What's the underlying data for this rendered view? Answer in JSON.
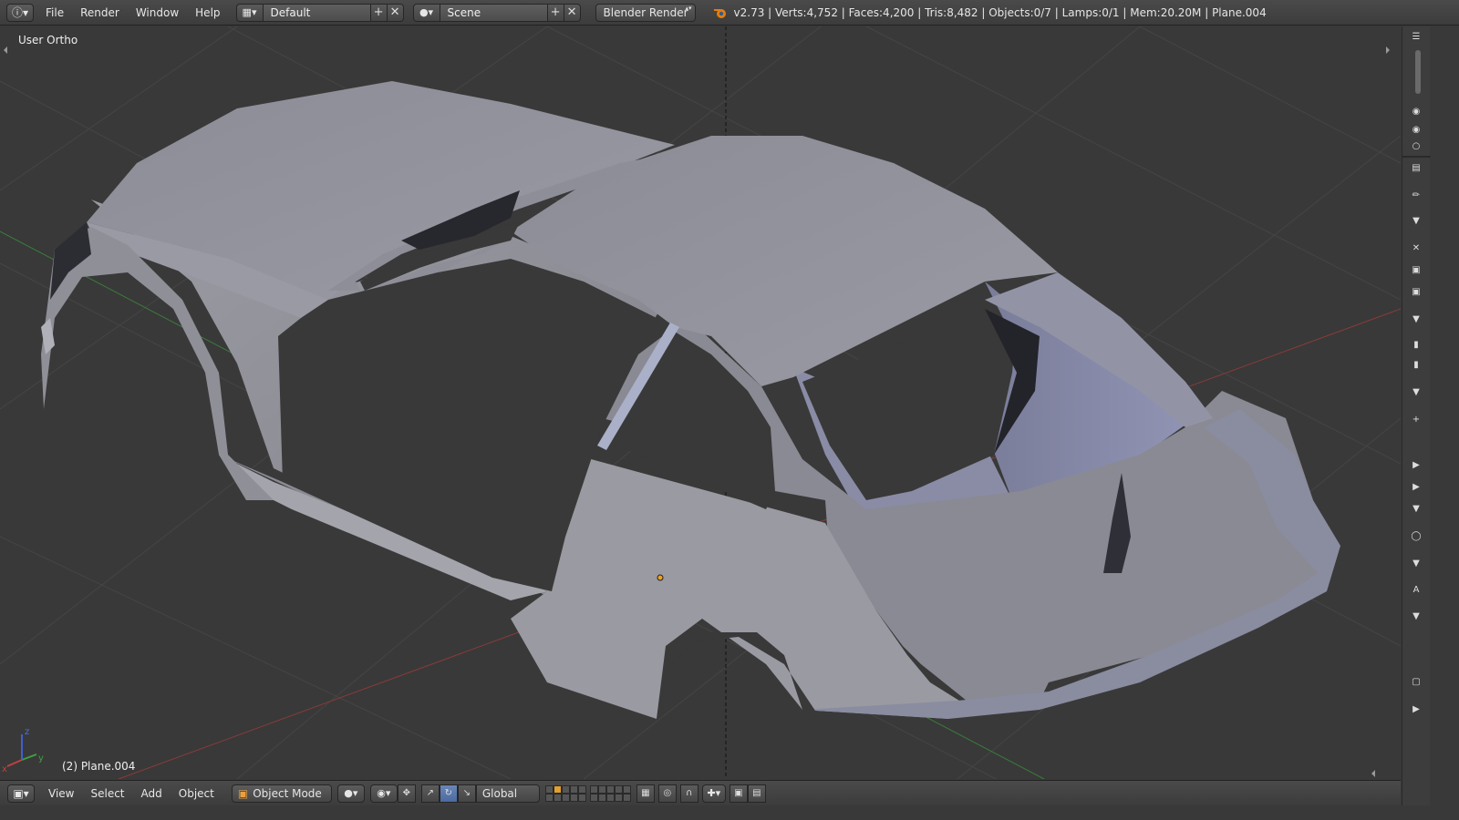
{
  "topbar": {
    "menus": [
      "File",
      "Render",
      "Window",
      "Help"
    ],
    "screen_layout": "Default",
    "scene": "Scene",
    "render_engine": "Blender Render",
    "stats": "v2.73 | Verts:4,752 | Faces:4,200 | Tris:8,482 | Objects:0/7 | Lamps:0/1 | Mem:20.20M | Plane.004"
  },
  "viewport": {
    "view_label": "User Ortho",
    "object_label": "(2) Plane.004",
    "axis_labels": {
      "x": "x",
      "y": "y",
      "z": "z"
    },
    "colors": {
      "background": "#393939",
      "grid": "#464646",
      "x_axis": "#a13a3a",
      "y_axis": "#3e8a3e",
      "mesh": "#8e8e99"
    }
  },
  "bottombar": {
    "menus": [
      "View",
      "Select",
      "Add",
      "Object"
    ],
    "mode": "Object Mode",
    "orientation": "Global"
  }
}
